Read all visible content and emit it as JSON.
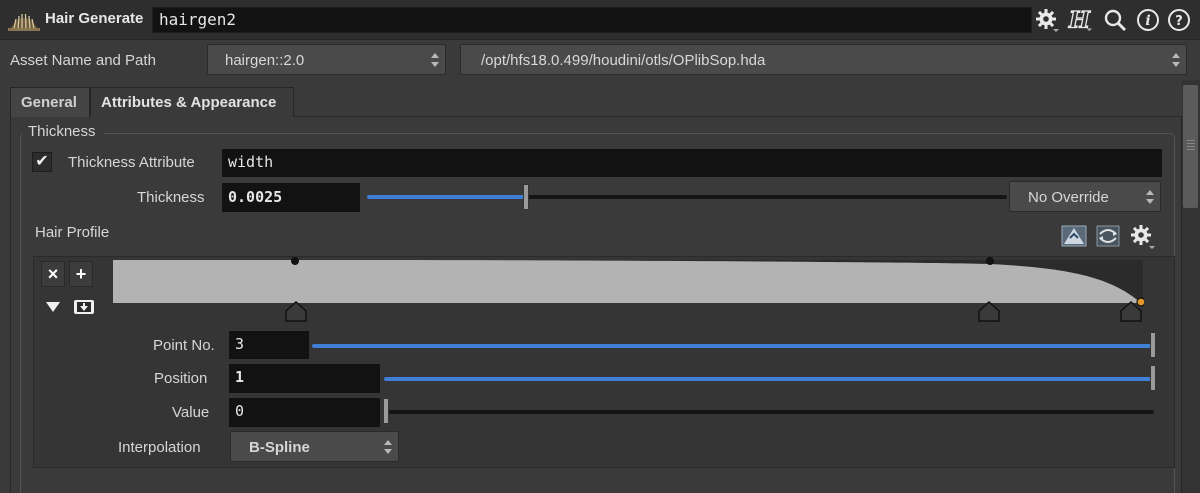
{
  "header": {
    "node_type": "Hair Generate",
    "node_name": "hairgen2",
    "icons": [
      "gear-icon",
      "houdini-help-icon",
      "search-icon",
      "info-icon",
      "help-icon"
    ]
  },
  "asset": {
    "label": "Asset Name and Path",
    "version": "hairgen::2.0",
    "path": "/opt/hfs18.0.499/houdini/otls/OPlibSop.hda"
  },
  "tabs": [
    {
      "label": "General",
      "active": false
    },
    {
      "label": "Attributes & Appearance",
      "active": true
    }
  ],
  "thickness_folder": {
    "title": "Thickness",
    "thickness_attribute": {
      "label": "Thickness Attribute",
      "checked": true,
      "value": "width"
    },
    "thickness": {
      "label": "Thickness",
      "value": "0.0025",
      "override": "No Override"
    }
  },
  "hair_profile": {
    "label": "Hair Profile",
    "ramp_toolbar_icons": [
      "ramp-preset-icon",
      "ramp-flip-icon",
      "gear-icon"
    ],
    "point_no": {
      "label": "Point No.",
      "value": "3"
    },
    "position": {
      "label": "Position",
      "value": "1"
    },
    "value": {
      "label": "Value",
      "value": "0"
    },
    "interpolation": {
      "label": "Interpolation",
      "value": "B-Spline"
    }
  },
  "colors": {
    "accent_blue": "#3f7fd6",
    "selected_key": "#e0962a",
    "ramp_fill": "#b3b3b3",
    "ramp_bg": "#2b2b2b"
  }
}
